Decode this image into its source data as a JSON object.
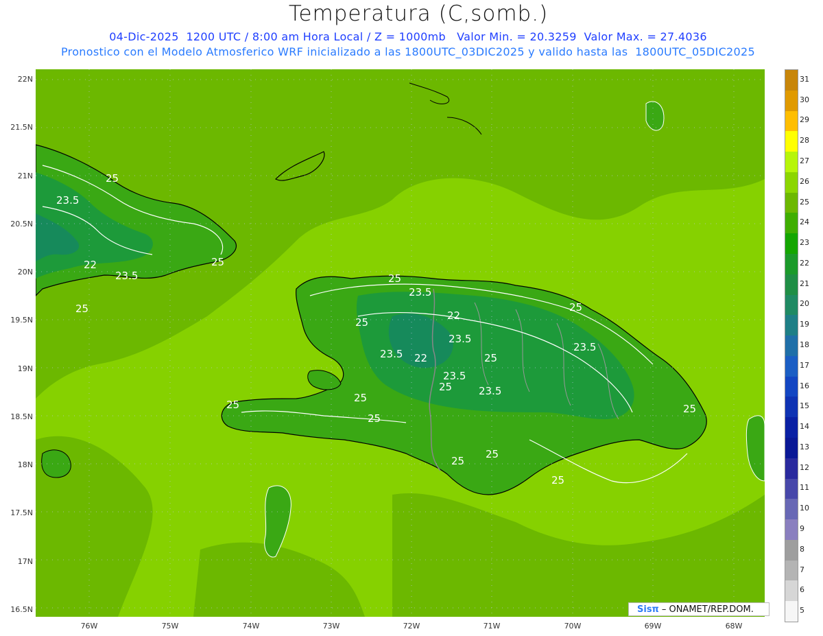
{
  "header": {
    "title": "Temperatura (C,somb.)",
    "line1": "04-Dic-2025  1200 UTC / 8:00 am Hora Local / Z = 1000mb   Valor Min. = 20.3259  Valor Max. = 27.4036",
    "line2": "Pronostico con el Modelo Atmosferico WRF inicializado a las 1800UTC_03DIC2025 y valido hasta las  1800UTC_05DIC2025"
  },
  "axes": {
    "y_ticks": [
      "22N",
      "21.5N",
      "21N",
      "20.5N",
      "20N",
      "19.5N",
      "19N",
      "18.5N",
      "18N",
      "17.5N",
      "17N",
      "16.5N"
    ],
    "x_ticks": [
      "76W",
      "75W",
      "74W",
      "73W",
      "72W",
      "71W",
      "70W",
      "69W",
      "68W"
    ]
  },
  "colorbar": {
    "levels": [
      "31",
      "30",
      "29",
      "28",
      "27",
      "26",
      "25",
      "24",
      "23",
      "22",
      "21",
      "20",
      "19",
      "18",
      "17",
      "16",
      "15",
      "14",
      "13",
      "12",
      "11",
      "10",
      "9",
      "8",
      "7",
      "6",
      "5"
    ],
    "colors": [
      "#c8860a",
      "#e09a00",
      "#ffbe00",
      "#ffff00",
      "#b7f50a",
      "#8cd600",
      "#6cb800",
      "#3fae00",
      "#14a600",
      "#1b9a2a",
      "#1f8e45",
      "#1f8a63",
      "#1e7f86",
      "#1f6fa8",
      "#1b5ec4",
      "#1346c2",
      "#0f33b3",
      "#0a20a4",
      "#0a1896",
      "#2a2a9e",
      "#4848aa",
      "#6868b5",
      "#8a7fbf",
      "#9e9e9e",
      "#b4b4b4",
      "#d6d6d6",
      "#f6f6f6"
    ]
  },
  "contour_labels": [
    "25",
    "23.5",
    "25",
    "22",
    "23.5",
    "25",
    "25",
    "25",
    "23.5",
    "25",
    "22",
    "23.5",
    "23.5",
    "22",
    "25",
    "23.5",
    "23.5",
    "25",
    "23.5",
    "25",
    "25",
    "25",
    "25",
    "25",
    "25",
    "25"
  ],
  "colors": {
    "sea_light": "#86d100",
    "sea_mid": "#6cb800",
    "land_dark": "#3aa814",
    "land_darker": "#1d9a3a",
    "coast": "#000000",
    "border": "#888888"
  },
  "credit": {
    "logo": "Sisπ",
    "text": "– ONAMET/REP.DOM."
  }
}
